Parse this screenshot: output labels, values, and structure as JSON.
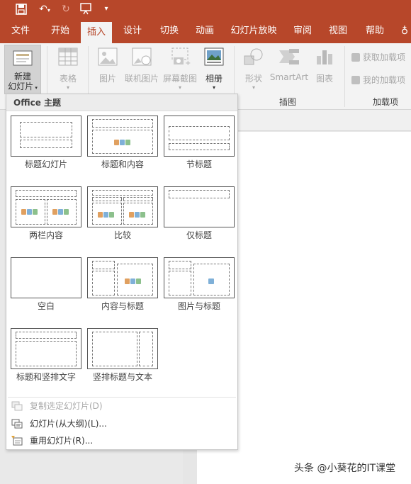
{
  "ribbon": {
    "tabs": [
      {
        "label": "文件"
      },
      {
        "label": "开始"
      },
      {
        "label": "插入"
      },
      {
        "label": "设计"
      },
      {
        "label": "切换"
      },
      {
        "label": "动画"
      },
      {
        "label": "幻灯片放映"
      },
      {
        "label": "审阅"
      },
      {
        "label": "视图"
      },
      {
        "label": "帮助"
      }
    ],
    "active_tab": "插入",
    "new_slide": {
      "line1": "新建",
      "line2": "幻灯片"
    },
    "table": "表格",
    "picture": "图片",
    "online_picture": "联机图片",
    "screenshot": "屏幕截图",
    "album": "相册",
    "shapes": "形状",
    "smartart": "SmartArt",
    "chart": "图表",
    "illustrations_group": "插图",
    "get_addins": "获取加载项",
    "my_addins": "我的加载项",
    "addins_group": "加载项"
  },
  "gallery": {
    "header": "Office 主题",
    "layouts": [
      {
        "name": "标题幻灯片"
      },
      {
        "name": "标题和内容"
      },
      {
        "name": "节标题"
      },
      {
        "name": "两栏内容"
      },
      {
        "name": "比较"
      },
      {
        "name": "仅标题"
      },
      {
        "name": "空白"
      },
      {
        "name": "内容与标题"
      },
      {
        "name": "图片与标题"
      },
      {
        "name": "标题和竖排文字"
      },
      {
        "name": "竖排标题与文本"
      }
    ],
    "menu": [
      {
        "label": "复制选定幻灯片(D)",
        "enabled": false
      },
      {
        "label": "幻灯片(从大纲)(L)...",
        "enabled": true
      },
      {
        "label": "重用幻灯片(R)...",
        "enabled": true
      }
    ]
  },
  "watermark": "头条 @小葵花的IT课堂",
  "colors": {
    "accent": "#b7472a",
    "ribbon_bg": "#f3f3f3"
  }
}
